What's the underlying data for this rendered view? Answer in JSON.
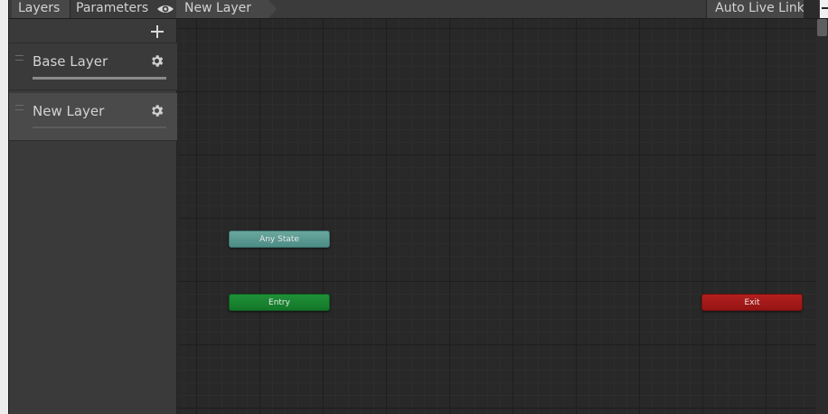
{
  "toolbar": {
    "tab_layers": "Layers",
    "tab_parameters": "Parameters",
    "eye_icon": "eye-icon",
    "breadcrumb": "New Layer",
    "auto_live_link": "Auto Live Link"
  },
  "layers_panel": {
    "add_icon": "plus-icon",
    "items": [
      {
        "name": "Base Layer",
        "settings_icon": "gear-icon"
      },
      {
        "name": "New Layer",
        "settings_icon": "gear-icon"
      }
    ]
  },
  "graph": {
    "nodes": {
      "any_state": {
        "label": "Any State",
        "color": "#5a9a92"
      },
      "entry": {
        "label": "Entry",
        "color": "#1a8531"
      },
      "exit": {
        "label": "Exit",
        "color": "#a81a1a"
      }
    }
  }
}
